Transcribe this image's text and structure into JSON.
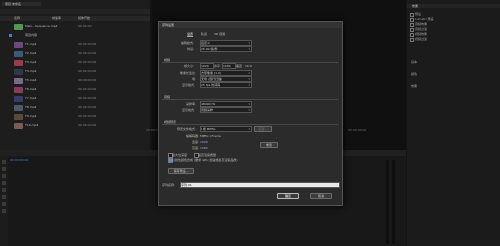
{
  "project": {
    "tab_title": "项目:未命名",
    "columns": [
      "名称",
      "帧速率",
      "媒体开始"
    ],
    "items": [
      {
        "name": "Main...Sequence.mp4",
        "rate": "00:00:00",
        "color": "#4f9a4f"
      },
      {
        "name": "项目内容",
        "rate": "",
        "color": "#5a7fb5"
      },
      {
        "name": "T1.mp4",
        "rate": "00:00:00:00",
        "color": "#6a4a7a"
      },
      {
        "name": "T2.mp4",
        "rate": "00:00:00:00",
        "color": "#3a5a7a"
      },
      {
        "name": "T3.mp4",
        "rate": "00:00:00:00",
        "color": "#9a3a4a"
      },
      {
        "name": "T4.mp4",
        "rate": "00:00:00:00",
        "color": "#2a3a4a"
      },
      {
        "name": "T5.mp4",
        "rate": "00:00:00:00",
        "color": "#7a6a8a"
      },
      {
        "name": "T6.mp4",
        "rate": "00:00:00:00",
        "color": "#8a3a5a"
      },
      {
        "name": "T7.mp4",
        "rate": "00:00:00:00",
        "color": "#3a3a6a"
      },
      {
        "name": "T8.mp4",
        "rate": "00:00:00:00",
        "color": "#4a5a6a"
      },
      {
        "name": "T9.mp4",
        "rate": "00:00:00:00",
        "color": "#5a4a3a"
      },
      {
        "name": "T10.mp4",
        "rate": "00:00:00:00",
        "color": "#7a5a5a"
      }
    ]
  },
  "monitor": {
    "timecode_left": "00:00:00:00",
    "timecode_right": "00:00:00:00"
  },
  "right_panel": {
    "title": "效果",
    "items": [
      "预设",
      "Lumetri 预设",
      "音频效果",
      "音频过渡",
      "视频效果",
      "视频过渡"
    ],
    "sub_items": [
      "基本",
      "颜色",
      "效果"
    ]
  },
  "timeline": {
    "timecode": "00:00:00:00",
    "label": "(未选择剪辑)"
  },
  "dialog": {
    "title": "序列设置",
    "tabs": [
      "设置",
      "轨道",
      "VR 视频"
    ],
    "editing_mode_label": "编辑模式:",
    "editing_mode_value": "自定义",
    "timebase_label": "时基:",
    "timebase_value": "25.00 帧/秒",
    "video_header": "视频",
    "frame_size_label": "帧大小:",
    "frame_width": "1920",
    "frame_height": "1080",
    "horizontal": "水平",
    "vertical": "垂直",
    "ratio": "16:9",
    "pixel_aspect_label": "像素长宽比:",
    "pixel_aspect_value": "方形像素 (1.0)",
    "fields_label": "场:",
    "fields_value": "无场 (逐行扫描)",
    "display_format_label": "显示格式:",
    "display_format_value": "25 fps 时间码",
    "audio_header": "音频",
    "sample_rate_label": "采样率:",
    "sample_rate_value": "48000 Hz",
    "audio_display_label": "显示格式:",
    "audio_display_value": "音频采样",
    "preview_header": "视频预览",
    "preview_format_label": "预览文件格式:",
    "preview_format_value": "I 帧 MPEG",
    "configure_btn": "配置...",
    "codec_label": "编解码器:",
    "codec_value": "MPEG I-Frame",
    "width_label": "宽度:",
    "width_value": "1920",
    "height_label": "高度:",
    "height_value": "1080",
    "reset_btn": "重置",
    "check_max_depth": "最大位深度",
    "check_max_quality": "最高渲染质量",
    "check_linear": "以线性颜色合成 (要求 GPU 加速或最高渲染品质)",
    "save_preset_btn": "保存预设...",
    "seq_name_label": "序列名称:",
    "seq_name_value": "序列 01",
    "ok_btn": "确定",
    "cancel_btn": "取消"
  },
  "status_text": "200 百分比 + 1 + 0 日月 + 0"
}
